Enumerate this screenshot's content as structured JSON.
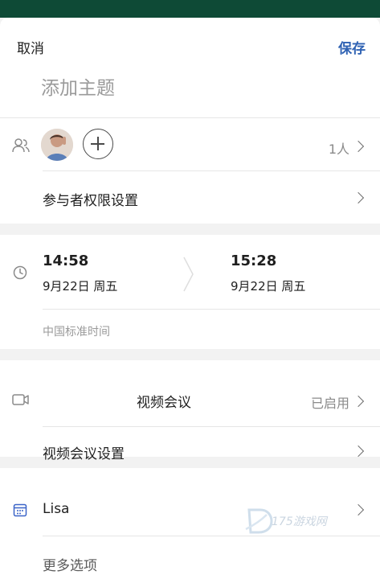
{
  "header": {
    "cancel_label": "取消",
    "save_label": "保存",
    "title_placeholder": "添加主题"
  },
  "participants": {
    "count_label": "1人",
    "permissions_label": "参与者权限设置"
  },
  "time": {
    "start_time": "14:58",
    "start_date": "9月22日 周五",
    "end_time": "15:28",
    "end_date": "9月22日 周五",
    "timezone": "中国标准时间"
  },
  "video": {
    "title": "视频会议",
    "status": "已启用",
    "settings_label": "视频会议设置"
  },
  "calendar": {
    "name": "Lisa",
    "more_label": "更多选项"
  },
  "watermark": {
    "text": "175游戏网"
  },
  "icons": {
    "people": "people-icon",
    "add": "plus-circle-icon",
    "chevron": "chevron-right-icon",
    "clock": "clock-icon",
    "video": "video-camera-icon",
    "calendar": "calendar-icon"
  },
  "colors": {
    "header_bar": "#0e4a36",
    "accent": "#2f62b3",
    "calendar_icon": "#3b64c8"
  }
}
